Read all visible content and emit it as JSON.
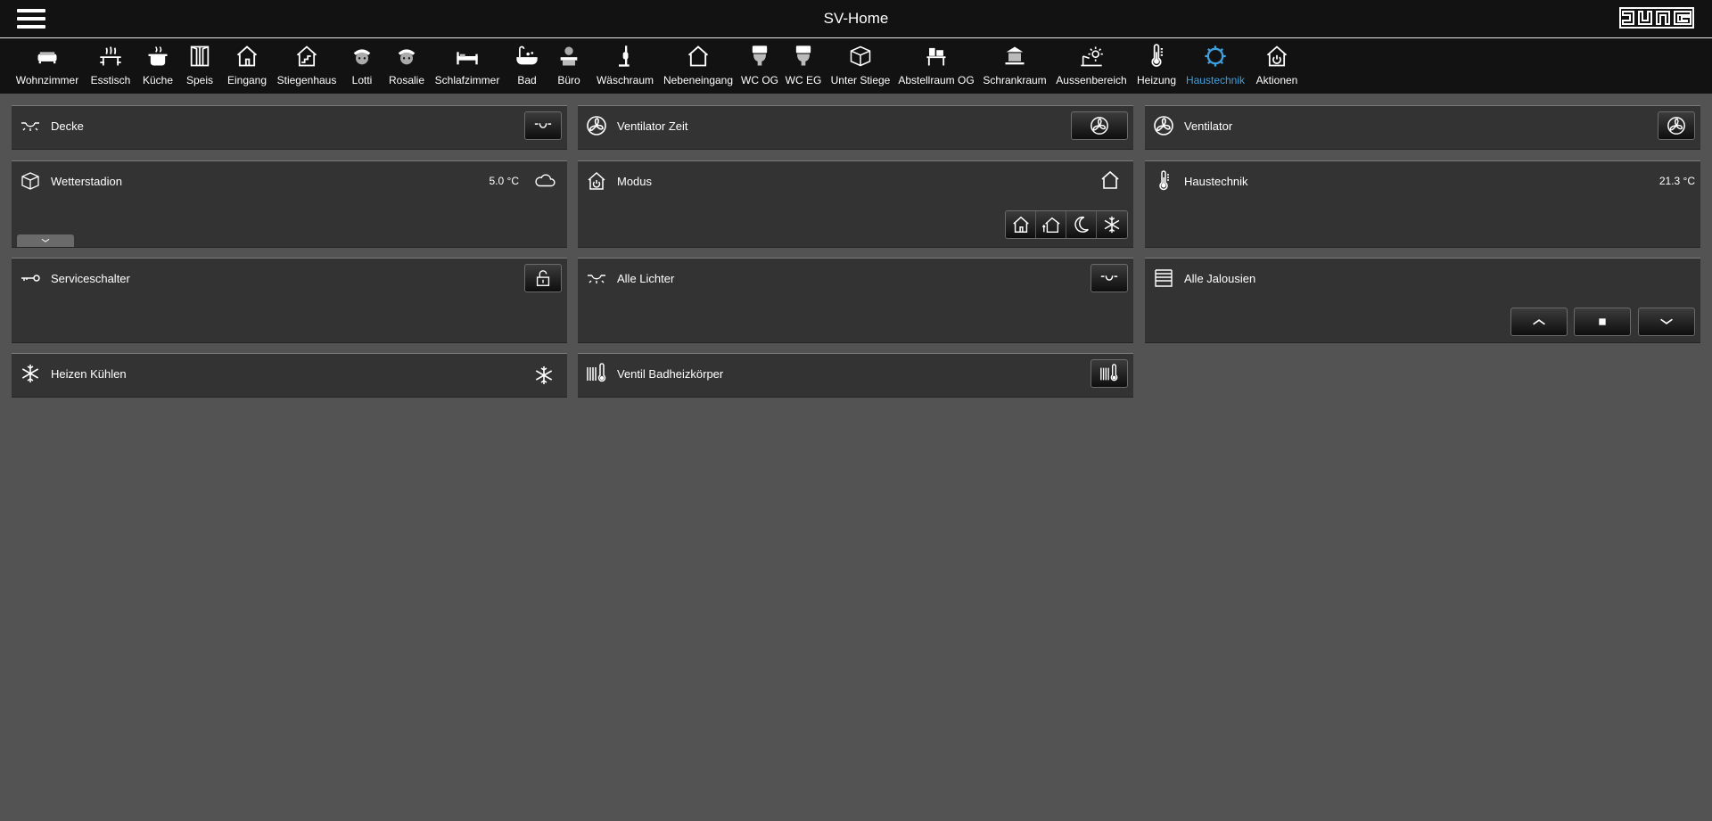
{
  "header": {
    "title": "SV-Home",
    "brand": "JUNG"
  },
  "colors": {
    "accent": "#3da0dc",
    "bar": "#121212",
    "tile": "#333333",
    "background": "#535353"
  },
  "nav": {
    "items": [
      {
        "label": "Wohnzimmer",
        "icon": "sofa-icon"
      },
      {
        "label": "Esstisch",
        "icon": "dining-table-icon"
      },
      {
        "label": "Küche",
        "icon": "cooking-pot-icon"
      },
      {
        "label": "Speis",
        "icon": "double-door-icon"
      },
      {
        "label": "Eingang",
        "icon": "house-entrance-icon"
      },
      {
        "label": "Stiegenhaus",
        "icon": "stairs-house-icon"
      },
      {
        "label": "Lotti",
        "icon": "child-face-icon"
      },
      {
        "label": "Rosalie",
        "icon": "child-face-icon"
      },
      {
        "label": "Schlafzimmer",
        "icon": "bed-icon"
      },
      {
        "label": "Bad",
        "icon": "bathtub-icon"
      },
      {
        "label": "Büro",
        "icon": "office-person-icon"
      },
      {
        "label": "Wäschraum",
        "icon": "vacuum-cleaner-icon"
      },
      {
        "label": "Nebeneingang",
        "icon": "house-icon"
      },
      {
        "label": "WC OG",
        "icon": "toilet-icon"
      },
      {
        "label": "WC EG",
        "icon": "toilet-icon"
      },
      {
        "label": "Unter Stiege",
        "icon": "box-icon"
      },
      {
        "label": "Abstellraum OG",
        "icon": "storage-shelf-icon"
      },
      {
        "label": "Schrankraum",
        "icon": "wardrobe-icon"
      },
      {
        "label": "Aussenbereich",
        "icon": "garden-sun-icon"
      },
      {
        "label": "Heizung",
        "icon": "thermometer-icon"
      },
      {
        "label": "Haustechnik",
        "icon": "gear-icon",
        "active": true
      },
      {
        "label": "Aktionen",
        "icon": "house-power-icon"
      }
    ]
  },
  "tiles": {
    "decke": {
      "label": "Decke",
      "icon": "ceiling-light-icon",
      "button_icon": "light-switch-icon"
    },
    "ventilator_zeit": {
      "label": "Ventilator Zeit",
      "icon": "fan-icon",
      "button_icon": "fan-icon"
    },
    "ventilator": {
      "label": "Ventilator",
      "icon": "fan-icon",
      "button_icon": "fan-icon"
    },
    "wetterstadion": {
      "label": "Wetterstadion",
      "value": "5.0 °C",
      "icon": "box-icon",
      "status_icon": "cloud-icon",
      "expand_icon": "chevron-down-icon"
    },
    "modus": {
      "label": "Modus",
      "icon": "house-power-icon",
      "status_icon": "house-icon",
      "buttons": [
        "house-icon",
        "house-arrow-icon",
        "moon-icon",
        "snowflake-icon"
      ]
    },
    "haustechnik": {
      "label": "Haustechnik",
      "value": "21.3 °C",
      "icon": "thermometer-icon"
    },
    "serviceschalter": {
      "label": "Serviceschalter",
      "icon": "key-icon",
      "button_icon": "lock-open-icon"
    },
    "alle_lichter": {
      "label": "Alle Lichter",
      "icon": "ceiling-light-icon",
      "button_icon": "light-switch-icon"
    },
    "alle_jalousien": {
      "label": "Alle Jalousien",
      "icon": "blinds-icon",
      "buttons": [
        "chevron-up-icon",
        "stop-icon",
        "chevron-down-icon"
      ]
    },
    "heizen_kuehlen": {
      "label": "Heizen Kühlen",
      "icon": "snowflake-icon",
      "status_icon": "snowflake-icon"
    },
    "ventil_bad": {
      "label": "Ventil Badheizkörper",
      "icon": "radiator-thermometer-icon",
      "button_icon": "radiator-thermometer-icon"
    }
  }
}
